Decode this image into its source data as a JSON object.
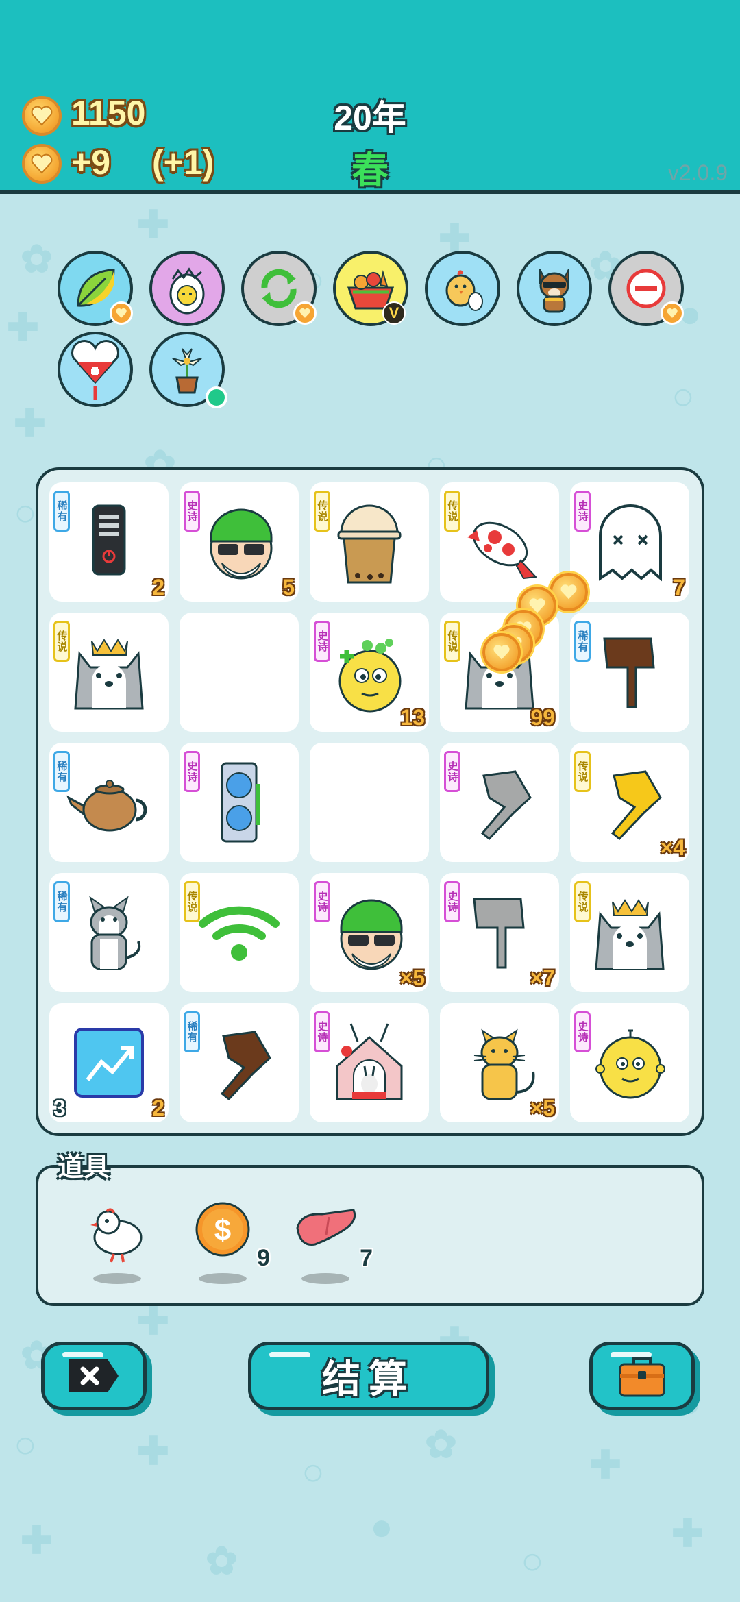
{
  "hud": {
    "coins": "1150",
    "income": "+9",
    "bonus": "(+1)",
    "year": "20年",
    "season": "春",
    "version": "v2.0.9"
  },
  "buffs": [
    {
      "icon": "leaf-icon"
    },
    {
      "icon": "hatched-egg-icon"
    },
    {
      "icon": "recycle-icon"
    },
    {
      "icon": "fruit-basket-icon",
      "badge": "V"
    },
    {
      "icon": "chick-egg-icon"
    },
    {
      "icon": "cool-dog-icon"
    },
    {
      "icon": "minus-circle-icon"
    },
    {
      "icon": "heart-medal-icon"
    },
    {
      "icon": "potted-flower-icon"
    }
  ],
  "board": {
    "cells": [
      {
        "tag": "稀有",
        "rarity": "rare",
        "icon": "phone-battery-icon",
        "count": "2"
      },
      {
        "tag": "史诗",
        "rarity": "epic",
        "icon": "green-hat-man-icon",
        "count": "5"
      },
      {
        "tag": "传说",
        "rarity": "legend",
        "icon": "bubble-tea-icon",
        "count": ""
      },
      {
        "tag": "传说",
        "rarity": "legend",
        "icon": "koi-fish-icon",
        "count": ""
      },
      {
        "tag": "史诗",
        "rarity": "epic",
        "icon": "ghost-icon",
        "count": "7"
      },
      {
        "tag": "传说",
        "rarity": "legend",
        "icon": "king-husky-icon",
        "count": ""
      },
      {
        "tag": "",
        "rarity": "",
        "icon": "",
        "count": ""
      },
      {
        "tag": "史诗",
        "rarity": "epic",
        "icon": "clover-face-icon",
        "count": "13"
      },
      {
        "tag": "传说",
        "rarity": "legend",
        "icon": "husky-icon",
        "count": "99"
      },
      {
        "tag": "稀有",
        "rarity": "rare",
        "icon": "brown-finger-down-icon",
        "count": ""
      },
      {
        "tag": "稀有",
        "rarity": "rare",
        "icon": "teapot-icon",
        "count": ""
      },
      {
        "tag": "史诗",
        "rarity": "epic",
        "icon": "graphics-card-icon",
        "count": ""
      },
      {
        "tag": "",
        "rarity": "",
        "icon": "",
        "count": ""
      },
      {
        "tag": "史诗",
        "rarity": "epic",
        "icon": "gray-finger-point-icon",
        "count": ""
      },
      {
        "tag": "传说",
        "rarity": "legend",
        "icon": "gold-finger-point-icon",
        "count": "×4"
      },
      {
        "tag": "稀有",
        "rarity": "rare",
        "icon": "sitting-husky-icon",
        "count": ""
      },
      {
        "tag": "传说",
        "rarity": "legend",
        "icon": "wifi-icon",
        "count": ""
      },
      {
        "tag": "史诗",
        "rarity": "epic",
        "icon": "green-hat-man-icon",
        "count": "×5"
      },
      {
        "tag": "史诗",
        "rarity": "epic",
        "icon": "gray-finger-down-icon",
        "count": "×7"
      },
      {
        "tag": "传说",
        "rarity": "legend",
        "icon": "king-husky-icon",
        "count": ""
      },
      {
        "tag": "",
        "rarity": "",
        "icon": "trend-chart-icon",
        "count": "2",
        "count_left": "3"
      },
      {
        "tag": "稀有",
        "rarity": "rare",
        "icon": "brown-finger-point-icon",
        "count": ""
      },
      {
        "tag": "史诗",
        "rarity": "epic",
        "icon": "rabbit-house-icon",
        "count": ""
      },
      {
        "tag": "",
        "rarity": "",
        "icon": "orange-cat-icon",
        "count": "×5"
      },
      {
        "tag": "史诗",
        "rarity": "epic",
        "icon": "yellow-face-icon",
        "count": ""
      }
    ]
  },
  "items": {
    "label": "道具",
    "list": [
      {
        "icon": "white-bird-icon",
        "count": ""
      },
      {
        "icon": "dollar-coin-icon",
        "count": "9"
      },
      {
        "icon": "liver-icon",
        "count": "7"
      }
    ]
  },
  "buttons": {
    "close_icon": "close-tag-icon",
    "settle": "结算",
    "bag_icon": "briefcase-icon"
  },
  "colors": {
    "header": "#1cbfbf",
    "background": "#bfe5ea",
    "outline": "#1a3b40",
    "button": "#22c3c8",
    "coin": "#f4a531"
  }
}
